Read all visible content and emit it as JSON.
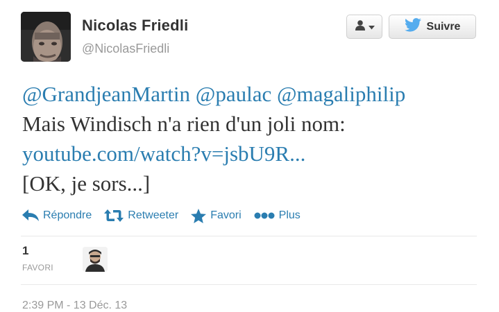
{
  "user": {
    "display_name": "Nicolas Friedli",
    "screen_name": "@NicolasFriedli",
    "avatar_icon": "user-photo"
  },
  "header": {
    "follow_label": "Suivre",
    "dropdown_icon": "person-icon"
  },
  "tweet": {
    "mention_1": "@GrandjeanMartin",
    "mention_2": "@paulac",
    "mention_3": "@magaliphilip",
    "body": "Mais Windisch n'a rien d'un joli nom:",
    "link": "youtube.com/watch?v=jsbU9R...",
    "tail": "[OK, je sors...]"
  },
  "actions": {
    "reply": "Répondre",
    "retweet": "Retweeter",
    "favorite": "Favori",
    "more": "Plus"
  },
  "stats": {
    "favorites_count": "1",
    "favorites_label": "FAVORI"
  },
  "timestamp": "2:39 PM - 13 Déc. 13",
  "colors": {
    "link": "#2a7db0",
    "twitter_bird": "#55acee",
    "muted": "#999999"
  }
}
